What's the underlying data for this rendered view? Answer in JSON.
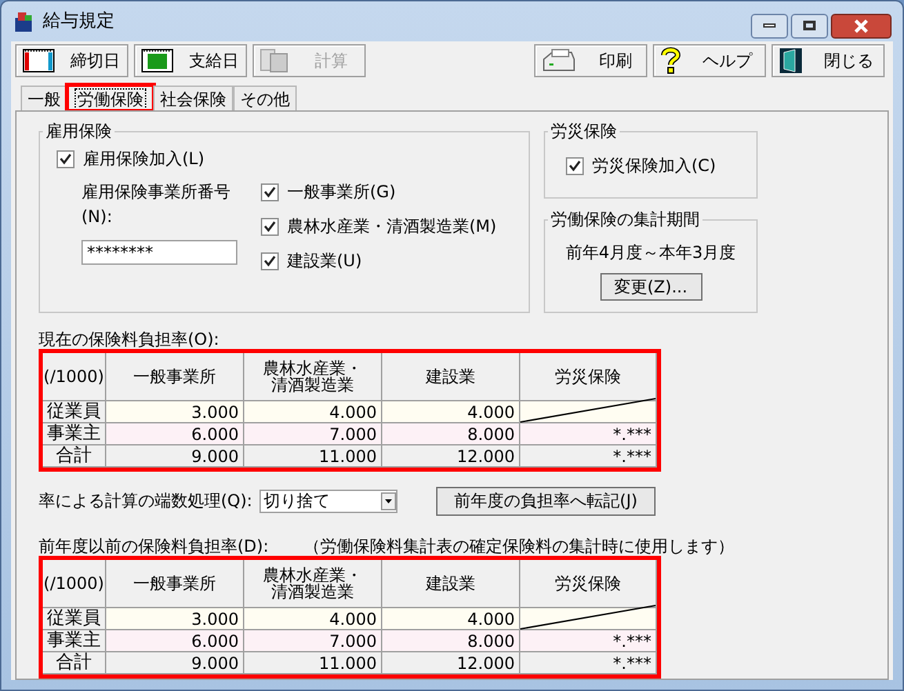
{
  "window": {
    "title": "給与規定"
  },
  "toolbar": {
    "left": [
      {
        "label": "締切日",
        "disabled": false
      },
      {
        "label": "支給日",
        "disabled": false
      },
      {
        "label": "計算",
        "disabled": true
      }
    ],
    "right": [
      {
        "label": "印刷",
        "disabled": false
      },
      {
        "label": "ヘルプ",
        "disabled": false
      },
      {
        "label": "閉じる",
        "disabled": false
      }
    ]
  },
  "tabs": [
    {
      "label": "一般",
      "selected": false,
      "highlighted": false
    },
    {
      "label": "労働保険",
      "selected": true,
      "highlighted": true
    },
    {
      "label": "社会保険",
      "selected": false,
      "highlighted": false
    },
    {
      "label": "その他",
      "selected": false,
      "highlighted": false
    }
  ],
  "employment": {
    "title": "雇用保険",
    "join": {
      "label": "雇用保険加入(L)",
      "checked": true
    },
    "number_label": "雇用保険事業所番号(N):",
    "number_value": "********",
    "categories": [
      {
        "label": "一般事業所(G)",
        "checked": true
      },
      {
        "label": "農林水産業・清酒製造業(M)",
        "checked": true
      },
      {
        "label": "建設業(U)",
        "checked": true
      }
    ]
  },
  "accident": {
    "title": "労災保険",
    "join": {
      "label": "労災保険加入(C)",
      "checked": true
    }
  },
  "period": {
    "title": "労働保険の集計期間",
    "text": "前年4月度～本年3月度",
    "button": "変更(Z)..."
  },
  "tables": [
    {
      "label": "現在の保険料負担率(O):",
      "highlighted": true,
      "unit": "(/1000)",
      "columns": [
        "一般事業所",
        "農林水産業・清酒製造業",
        "建設業",
        "労災保険"
      ],
      "rows": [
        {
          "label": "従業員",
          "color": "#fffdf2",
          "cells": [
            {
              "kind": "value",
              "text": "3.000"
            },
            {
              "kind": "value",
              "text": "4.000"
            },
            {
              "kind": "value",
              "text": "4.000"
            },
            {
              "kind": "diagonal"
            }
          ]
        },
        {
          "label": "事業主",
          "color": "#fdf1f6",
          "cells": [
            {
              "kind": "value",
              "text": "6.000"
            },
            {
              "kind": "value",
              "text": "7.000"
            },
            {
              "kind": "value",
              "text": "8.000"
            },
            {
              "kind": "value",
              "text": "*.***"
            }
          ]
        },
        {
          "label": "合計",
          "color": "#f0f0f0",
          "cells": [
            {
              "kind": "value",
              "text": "9.000"
            },
            {
              "kind": "value",
              "text": "11.000"
            },
            {
              "kind": "value",
              "text": "12.000"
            },
            {
              "kind": "value",
              "text": "*.***"
            }
          ]
        }
      ]
    },
    {
      "label": "前年度以前の保険料負担率(D):",
      "note": "（労働保険料集計表の確定保険料の集計時に使用します）",
      "highlighted": true,
      "unit": "(/1000)",
      "columns": [
        "一般事業所",
        "農林水産業・清酒製造業",
        "建設業",
        "労災保険"
      ],
      "rows": [
        {
          "label": "従業員",
          "color": "#fffdf2",
          "cells": [
            {
              "kind": "value",
              "text": "3.000"
            },
            {
              "kind": "value",
              "text": "4.000"
            },
            {
              "kind": "value",
              "text": "4.000"
            },
            {
              "kind": "diagonal"
            }
          ]
        },
        {
          "label": "事業主",
          "color": "#fdf1f6",
          "cells": [
            {
              "kind": "value",
              "text": "6.000"
            },
            {
              "kind": "value",
              "text": "7.000"
            },
            {
              "kind": "value",
              "text": "8.000"
            },
            {
              "kind": "value",
              "text": "*.***"
            }
          ]
        },
        {
          "label": "合計",
          "color": "#f0f0f0",
          "cells": [
            {
              "kind": "value",
              "text": "9.000"
            },
            {
              "kind": "value",
              "text": "11.000"
            },
            {
              "kind": "value",
              "text": "12.000"
            },
            {
              "kind": "value",
              "text": "*.***"
            }
          ]
        }
      ]
    }
  ],
  "rounding": {
    "label": "率による計算の端数処理(Q):",
    "value": "切り捨て",
    "transfer_button": "前年度の負担率へ転記(J)"
  }
}
